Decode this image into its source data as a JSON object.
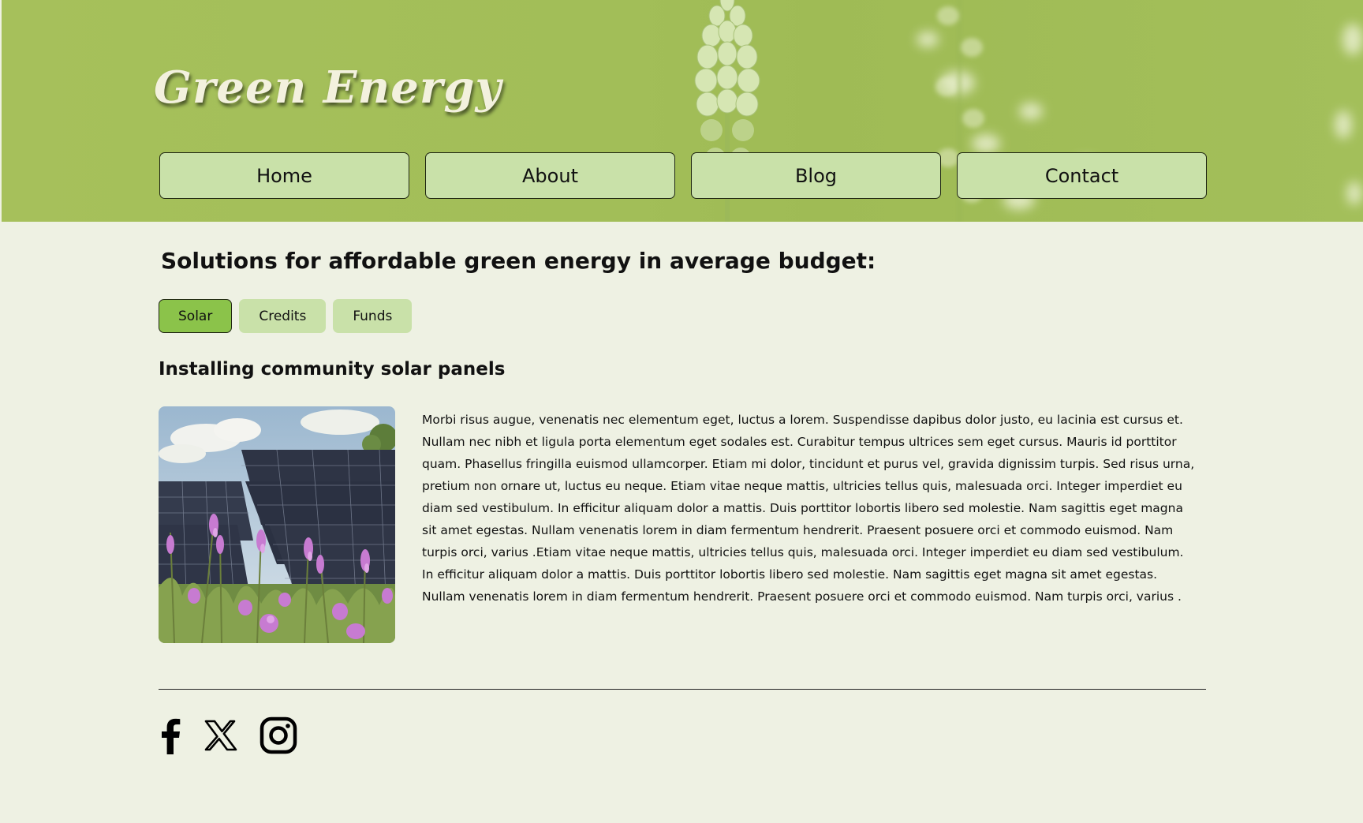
{
  "header": {
    "site_title": "Green Energy",
    "nav": [
      {
        "label": "Home"
      },
      {
        "label": "About"
      },
      {
        "label": "Blog"
      },
      {
        "label": "Contact"
      }
    ]
  },
  "main": {
    "heading": "Solutions for affordable green energy in average budget:",
    "tabs": [
      {
        "label": "Solar",
        "active": true
      },
      {
        "label": "Credits",
        "active": false
      },
      {
        "label": "Funds",
        "active": false
      }
    ],
    "section_title": "Installing community solar panels",
    "image_icon": "solar-panels-photo",
    "body": "Morbi risus augue, venenatis nec elementum eget, luctus a lorem. Suspendisse dapibus dolor justo, eu lacinia est cursus et. Nullam nec nibh et ligula porta elementum eget sodales est. Curabitur tempus ultrices sem eget cursus. Mauris id porttitor quam. Phasellus fringilla euismod ullamcorper. Etiam mi dolor, tincidunt et purus vel, gravida dignissim turpis. Sed risus urna, pretium non ornare ut, luctus eu neque. Etiam vitae neque mattis, ultricies tellus quis, malesuada orci. Integer imperdiet eu diam sed vestibulum. In efficitur aliquam dolor a mattis. Duis porttitor lobortis libero sed molestie. Nam sagittis eget magna sit amet egestas. Nullam venenatis lorem in diam fermentum hendrerit. Praesent posuere orci et commodo euismod. Nam turpis orci, varius .Etiam vitae neque mattis, ultricies tellus quis, malesuada orci. Integer imperdiet eu diam sed vestibulum. In efficitur aliquam dolor a mattis. Duis porttitor lobortis libero sed molestie. Nam sagittis eget magna sit amet egestas. Nullam venenatis lorem in diam fermentum hendrerit. Praesent posuere orci et commodo euismod. Nam turpis orci, varius ."
  },
  "footer": {
    "social_icons": [
      "facebook-icon",
      "x-icon",
      "instagram-icon"
    ]
  },
  "colors": {
    "page_bg": "#eef1e3",
    "header_bg": "#a2be58",
    "nav_button_bg": "#c9e1a9",
    "tab_active_bg": "#8bc34a",
    "tab_bg": "#c9e1a9"
  }
}
